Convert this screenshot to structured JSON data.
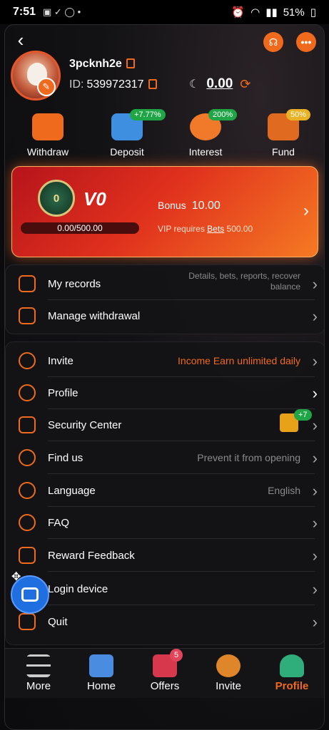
{
  "status": {
    "time": "7:51",
    "battery": "51%"
  },
  "user": {
    "name": "3pcknh2e",
    "id_label": "ID:",
    "id": "539972317",
    "balance": "0.00"
  },
  "actions": [
    {
      "label": "Withdraw",
      "badge": ""
    },
    {
      "label": "Deposit",
      "badge": "+7.77%"
    },
    {
      "label": "Interest",
      "badge": "200%"
    },
    {
      "label": "Fund",
      "badge": "50%"
    }
  ],
  "vip": {
    "badge_num": "0",
    "level": "V0",
    "progress": "0.00/500.00",
    "progress_fraction": 0,
    "bonus_label": "Bonus",
    "bonus_value": "10.00",
    "req_text": "VIP requires",
    "req_link": "Bets",
    "req_value": "500.00"
  },
  "records": [
    {
      "label": "My records",
      "note": "Details, bets, reports, recover balance"
    },
    {
      "label": "Manage withdrawal",
      "note": ""
    }
  ],
  "menu": [
    {
      "label": "Invite",
      "note": "Income Earn unlimited daily"
    },
    {
      "label": "Profile",
      "note": ""
    },
    {
      "label": "Security Center",
      "note": "",
      "badge": "+7"
    },
    {
      "label": "Find us",
      "note": "Prevent it from opening"
    },
    {
      "label": "Language",
      "note": "English"
    },
    {
      "label": "FAQ",
      "note": ""
    },
    {
      "label": "Reward Feedback",
      "note": ""
    },
    {
      "label": "Login device",
      "note": ""
    },
    {
      "label": "Quit",
      "note": ""
    }
  ],
  "tabs": [
    {
      "label": "More"
    },
    {
      "label": "Home"
    },
    {
      "label": "Offers",
      "badge": "5"
    },
    {
      "label": "Invite"
    },
    {
      "label": "Profile"
    }
  ]
}
